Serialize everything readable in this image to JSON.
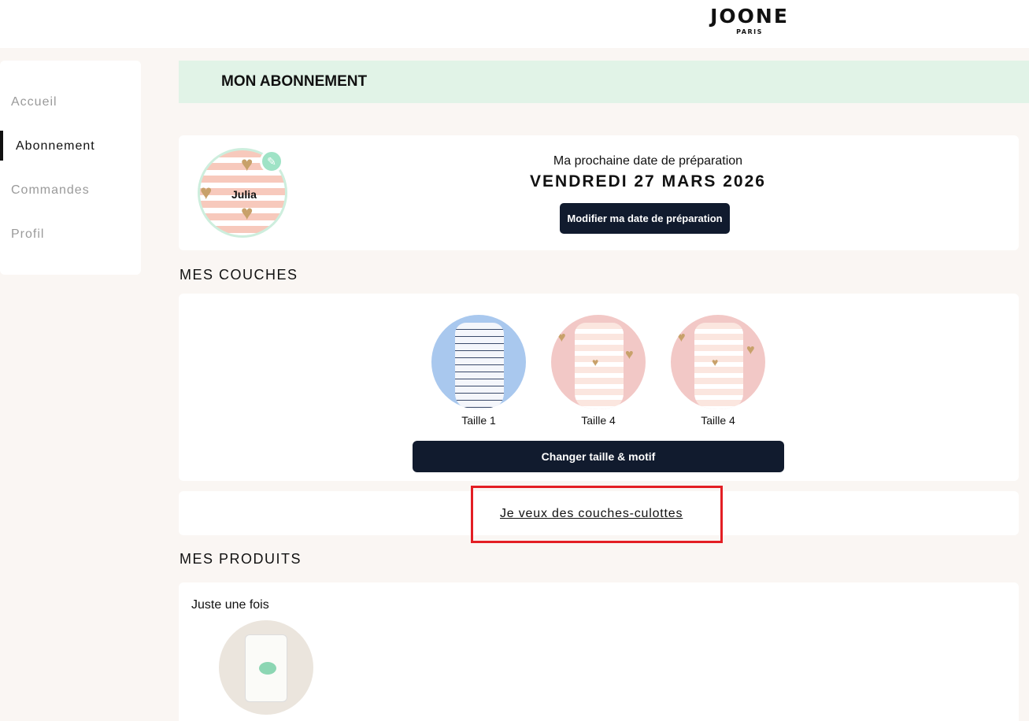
{
  "header": {
    "brand": "JOONE",
    "brand_sub": "PARIS"
  },
  "sidebar": {
    "items": [
      {
        "label": "Accueil",
        "active": false
      },
      {
        "label": "Abonnement",
        "active": true
      },
      {
        "label": "Commandes",
        "active": false
      },
      {
        "label": "Profil",
        "active": false
      }
    ]
  },
  "banner": {
    "title": "MON ABONNEMENT"
  },
  "preparation": {
    "child_name": "Julia",
    "label": "Ma prochaine date de préparation",
    "date": "VENDREDI 27 MARS 2026",
    "button": "Modifier ma date de préparation"
  },
  "couches": {
    "title": "MES COUCHES",
    "items": [
      {
        "label": "Taille 1",
        "motif": "blue-waves"
      },
      {
        "label": "Taille 4",
        "motif": "pink-hearts"
      },
      {
        "label": "Taille 4",
        "motif": "pink-hearts"
      }
    ],
    "button": "Changer taille & motif"
  },
  "culottes": {
    "link": "Je veux des couches-culottes"
  },
  "produits": {
    "title": "MES PRODUITS",
    "subtitle": "Juste une fois"
  },
  "icons": {
    "edit": "pencil-icon",
    "heart": "heart-icon"
  },
  "colors": {
    "accent_dark": "#111b2e",
    "banner_green": "#e1f3e7",
    "highlight_red": "#e31e24",
    "background": "#faf6f3"
  }
}
